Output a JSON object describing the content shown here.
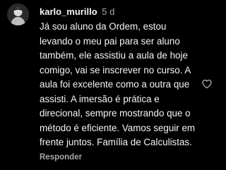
{
  "comment": {
    "username": "karlo_murillo",
    "timestamp": "5 d",
    "text": "Já sou aluno da Ordem, estou levando o meu pai para ser aluno também, ele assistiu a aula de hoje comigo, vai se inscrever no curso. A aula foi excelente como a outra que assisti. A imersão é prática e direcional, sempre mostrando que o método é eficiente. Vamos seguir em frente juntos. Família de Calculistas.",
    "reply_label": "Responder",
    "avatar_icon": "user-avatar-photo",
    "like_icon": "heart-outline-icon"
  },
  "colors": {
    "background": "#000000",
    "primary_text": "#f5f5f5",
    "secondary_text": "#a8a8a8"
  }
}
